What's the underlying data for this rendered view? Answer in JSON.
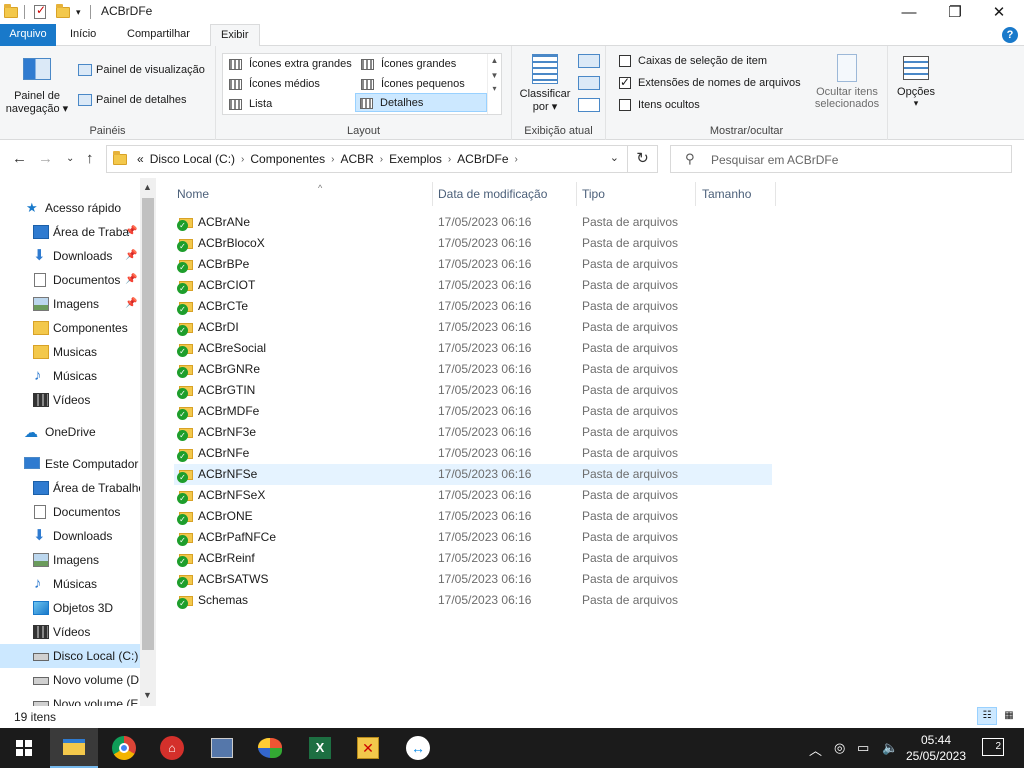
{
  "window": {
    "title": "ACBrDFe"
  },
  "tabs": {
    "file": "Arquivo",
    "home": "Início",
    "share": "Compartilhar",
    "view": "Exibir"
  },
  "ribbon": {
    "panes": {
      "nav_pane_l1": "Painel de",
      "nav_pane_l2": "navegação",
      "preview": "Painel de visualização",
      "details": "Painel de detalhes",
      "group": "Painéis"
    },
    "layout": {
      "items": [
        "Ícones extra grandes",
        "Ícones grandes",
        "Ícones médios",
        "Ícones pequenos",
        "Lista",
        "Detalhes"
      ],
      "group": "Layout"
    },
    "current_view": {
      "sort_l1": "Classificar",
      "sort_l2": "por",
      "group": "Exibição atual"
    },
    "show_hide": {
      "checkbox_items": "Caixas de seleção de item",
      "extensions": "Extensões de nomes de arquivos",
      "hidden": "Itens ocultos",
      "hide_sel_l1": "Ocultar itens",
      "hide_sel_l2": "selecionados",
      "group": "Mostrar/ocultar"
    },
    "options": "Opções"
  },
  "address": {
    "crumbs": [
      "Disco Local (C:)",
      "Componentes",
      "ACBR",
      "Exemplos",
      "ACBrDFe"
    ],
    "prefix": "«",
    "search_placeholder": "Pesquisar em ACBrDFe"
  },
  "navpane": {
    "quick_access": "Acesso rápido",
    "quick_items": [
      "Área de Traba",
      "Downloads",
      "Documentos",
      "Imagens",
      "Componentes",
      "Musicas",
      "Músicas",
      "Vídeos"
    ],
    "onedrive": "OneDrive",
    "this_pc": "Este Computador",
    "pc_items": [
      "Área de Trabalho",
      "Documentos",
      "Downloads",
      "Imagens",
      "Músicas",
      "Objetos 3D",
      "Vídeos",
      "Disco Local (C:)",
      "Novo volume (D",
      "Novo volume (E"
    ]
  },
  "columns": {
    "name": "Nome",
    "date": "Data de modificação",
    "type": "Tipo",
    "size": "Tamanho"
  },
  "files": [
    {
      "name": "ACBrANe",
      "date": "17/05/2023 06:16",
      "type": "Pasta de arquivos"
    },
    {
      "name": "ACBrBlocoX",
      "date": "17/05/2023 06:16",
      "type": "Pasta de arquivos"
    },
    {
      "name": "ACBrBPe",
      "date": "17/05/2023 06:16",
      "type": "Pasta de arquivos"
    },
    {
      "name": "ACBrCIOT",
      "date": "17/05/2023 06:16",
      "type": "Pasta de arquivos"
    },
    {
      "name": "ACBrCTe",
      "date": "17/05/2023 06:16",
      "type": "Pasta de arquivos"
    },
    {
      "name": "ACBrDI",
      "date": "17/05/2023 06:16",
      "type": "Pasta de arquivos"
    },
    {
      "name": "ACBreSocial",
      "date": "17/05/2023 06:16",
      "type": "Pasta de arquivos"
    },
    {
      "name": "ACBrGNRe",
      "date": "17/05/2023 06:16",
      "type": "Pasta de arquivos"
    },
    {
      "name": "ACBrGTIN",
      "date": "17/05/2023 06:16",
      "type": "Pasta de arquivos"
    },
    {
      "name": "ACBrMDFe",
      "date": "17/05/2023 06:16",
      "type": "Pasta de arquivos"
    },
    {
      "name": "ACBrNF3e",
      "date": "17/05/2023 06:16",
      "type": "Pasta de arquivos"
    },
    {
      "name": "ACBrNFe",
      "date": "17/05/2023 06:16",
      "type": "Pasta de arquivos"
    },
    {
      "name": "ACBrNFSe",
      "date": "17/05/2023 06:16",
      "type": "Pasta de arquivos"
    },
    {
      "name": "ACBrNFSeX",
      "date": "17/05/2023 06:16",
      "type": "Pasta de arquivos"
    },
    {
      "name": "ACBrONE",
      "date": "17/05/2023 06:16",
      "type": "Pasta de arquivos"
    },
    {
      "name": "ACBrPafNFCe",
      "date": "17/05/2023 06:16",
      "type": "Pasta de arquivos"
    },
    {
      "name": "ACBrReinf",
      "date": "17/05/2023 06:16",
      "type": "Pasta de arquivos"
    },
    {
      "name": "ACBrSATWS",
      "date": "17/05/2023 06:16",
      "type": "Pasta de arquivos"
    },
    {
      "name": "Schemas",
      "date": "17/05/2023 06:16",
      "type": "Pasta de arquivos"
    }
  ],
  "status": {
    "count": "19 itens"
  },
  "taskbar": {
    "time": "05:44",
    "date": "25/05/2023",
    "notifications": "2"
  },
  "colors": {
    "accent": "#1979ca",
    "selection": "#cce8ff",
    "hover": "#e5f3ff",
    "folder": "#f3c84b",
    "sync_ok": "#1e9e2c",
    "taskbar": "#1b1b1b"
  }
}
